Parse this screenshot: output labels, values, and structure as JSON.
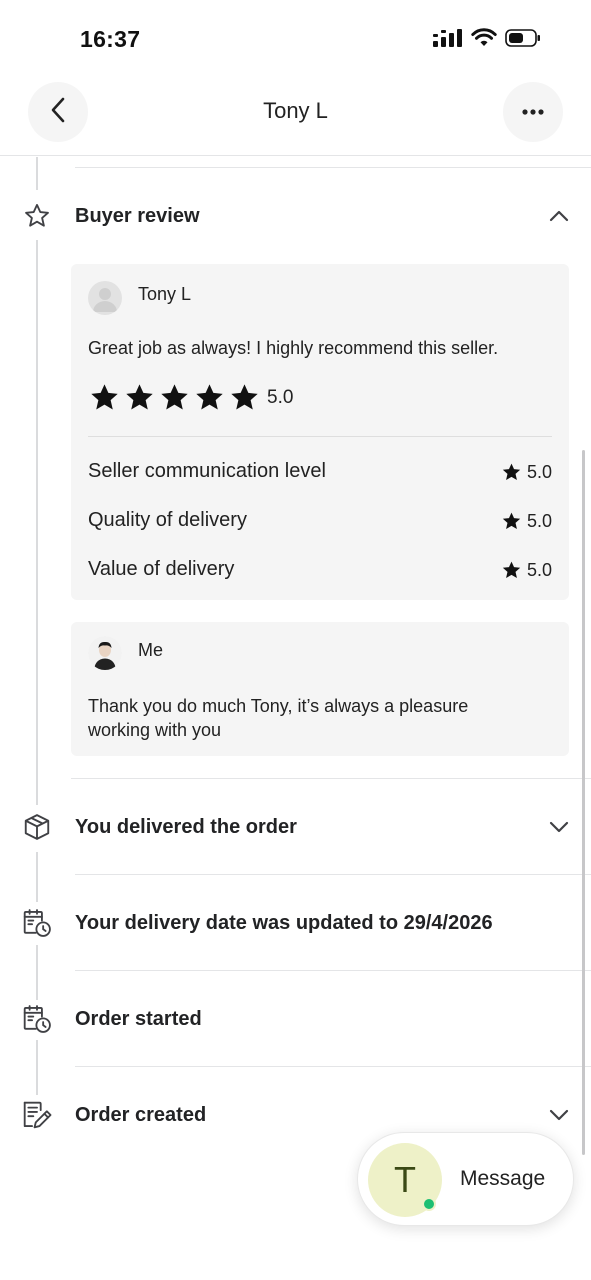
{
  "status_bar": {
    "time": "16:37"
  },
  "header": {
    "title": "Tony L",
    "back_icon": "chevron-left-icon",
    "more_icon": "more-horizontal-icon"
  },
  "timeline": {
    "buyer_review": {
      "label": "Buyer review",
      "icon": "star-outline-icon",
      "expanded": true,
      "review": {
        "reviewer": "Tony L",
        "text": "Great job as always! I highly recommend this seller.",
        "rating": "5.0",
        "stars": 5,
        "metrics": [
          {
            "label": "Seller communication level",
            "score": "5.0"
          },
          {
            "label": "Quality of delivery",
            "score": "5.0"
          },
          {
            "label": "Value of delivery",
            "score": "5.0"
          }
        ]
      },
      "reply": {
        "author": "Me",
        "text": "Thank you do much Tony, it’s always a pleasure working with you"
      }
    },
    "events": [
      {
        "label": "You delivered the order",
        "icon": "package-icon",
        "expandable": true
      },
      {
        "label": "Your delivery date was updated to 29/4/2026",
        "icon": "calendar-clock-icon",
        "expandable": false
      },
      {
        "label": "Order started",
        "icon": "calendar-clock-icon",
        "expandable": false
      },
      {
        "label": "Order created",
        "icon": "document-edit-icon",
        "expandable": true
      }
    ]
  },
  "message_button": {
    "label": "Message",
    "avatar_initial": "T",
    "online": true
  },
  "colors": {
    "online_green": "#1dbf73",
    "avatar_bg": "#eef1c8",
    "card_bg": "#f5f5f5"
  }
}
